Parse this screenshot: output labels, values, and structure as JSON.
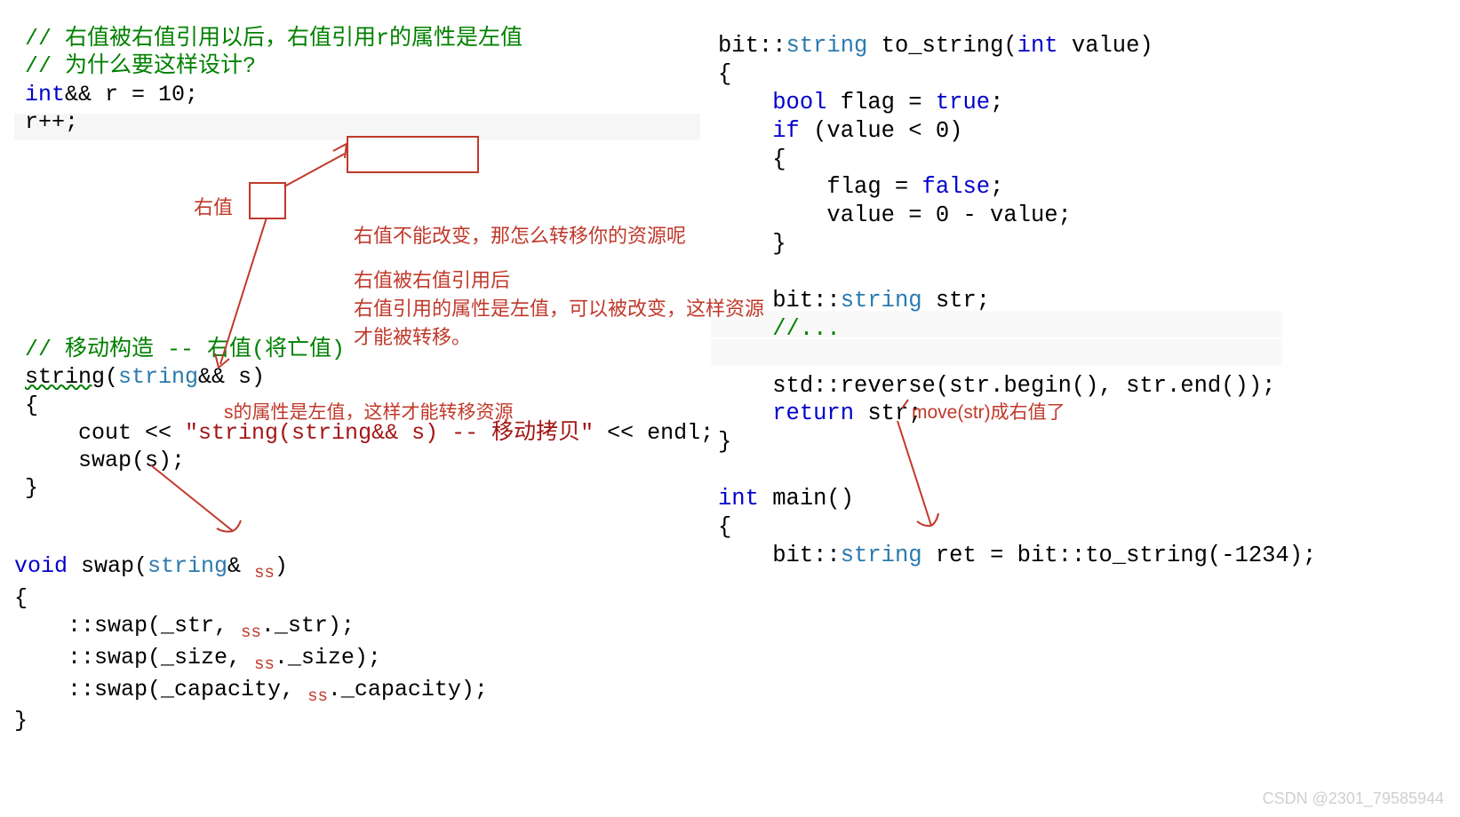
{
  "left": {
    "comment1": "// 右值被右值引用以后，右值引用r的属性是左值",
    "comment2": "// 为什么要这样设计?",
    "decl_pre": "int",
    "decl_post": "&& r = 10;",
    "incr": "r++;",
    "move_comment": "// 移动构造 -- 右值(将亡值)",
    "ctor_name": "string",
    "ctor_param_type": "string",
    "ctor_param_rest": "&& s)",
    "ctor_open": "{",
    "ctor_line1_pre": "    cout << ",
    "ctor_line1_str": "\"string(string&& s) -- 移动拷贝\"",
    "ctor_line1_post": " << endl;",
    "ctor_line2": "    swap(s);",
    "ctor_close": "}",
    "swap_kw": "void",
    "swap_name": " swap(",
    "swap_ptype": "string",
    "swap_prest": "& ",
    "swap_pvar": "ss",
    "swap_prest2": ")",
    "swap_open": "{",
    "swap_l1a": "    ::swap(_str, ",
    "swap_l1b": "._str);",
    "swap_l2a": "    ::swap(_size, ",
    "swap_l2b": "._size);",
    "swap_l3a": "    ::swap(_capacity, ",
    "swap_l3b": "._capacity);",
    "swap_close": "}",
    "ss_var": "ss"
  },
  "right": {
    "l1_a": "bit::",
    "l1_b": "string",
    "l1_c": " to_string(",
    "l1_d": "int",
    "l1_e": " value)",
    "l2": "{",
    "l3_a": "    ",
    "l3_b": "bool",
    "l3_c": " flag = ",
    "l3_d": "true",
    "l3_e": ";",
    "l4_a": "    ",
    "l4_b": "if",
    "l4_c": " (value < 0)",
    "l5": "    {",
    "l6_a": "        flag = ",
    "l6_b": "false",
    "l6_c": ";",
    "l7": "        value = 0 - value;",
    "l8": "    }",
    "l9": "",
    "l10_a": "    bit::",
    "l10_b": "string",
    "l10_c": " str;",
    "l11": "    //...",
    "l12": "",
    "l13_a": "    std::",
    "l13_b": "reverse",
    "l13_c": "(str.begin(), str.end());",
    "l14_a": "    ",
    "l14_b": "return",
    "l14_c": " str;",
    "l15": "}",
    "l16": "",
    "l17_a": "int",
    "l17_b": " main()",
    "l18": "{",
    "l19_a": "    bit::",
    "l19_b": "string",
    "l19_c": " ret = bit::to_string(-1234);"
  },
  "annotations": {
    "a_rvalue": "右值",
    "a_cannot": "右值不能改变，那怎么转移你的资源呢",
    "a_after1": "右值被右值引用后",
    "a_after2": "右值引用的属性是左值，可以被改变，这样资源",
    "a_after3": "才能被转移。",
    "a_s_attr": "s的属性是左值，这样才能转移资源",
    "a_move": "move(str)成右值了"
  },
  "watermark": "CSDN @2301_79585944"
}
